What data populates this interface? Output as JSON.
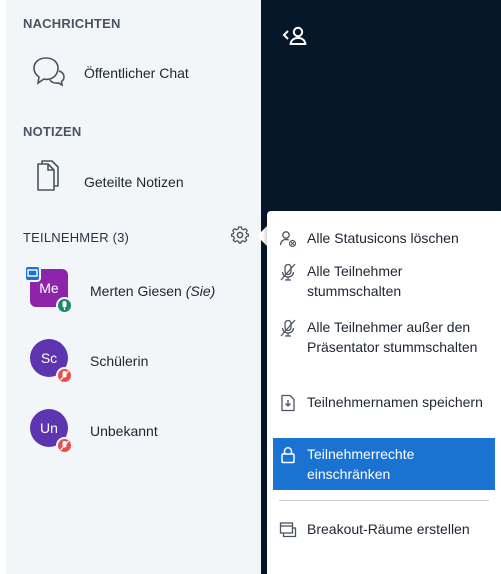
{
  "sidebar": {
    "messages_title": "NACHRICHTEN",
    "public_chat": "Öffentlicher Chat",
    "notes_title": "NOTIZEN",
    "shared_notes": "Geteilte Notizen",
    "participants_title": "TEILNEHMER (3)"
  },
  "users": [
    {
      "initials": "Me",
      "name": "Merten Giesen",
      "you_suffix": "(Sie)",
      "color": "#8e24aa",
      "role": "presenter",
      "audio": "microphone"
    },
    {
      "initials": "Sc",
      "name": "Schülerin",
      "color": "#5e35b1",
      "audio": "muted"
    },
    {
      "initials": "Un",
      "name": "Unbekannt",
      "color": "#5e35b1",
      "audio": "muted"
    }
  ],
  "menu": {
    "items": [
      {
        "label": "Alle Statusicons löschen",
        "icon": "clear-status-icon"
      },
      {
        "label": "Alle Teilnehmer stummschalten",
        "icon": "mute-icon"
      },
      {
        "label": "Alle Teilnehmer außer den Präsentator stummschalten",
        "icon": "mute-icon"
      },
      {
        "label": "Teilnehmernamen speichern",
        "icon": "save-file-icon"
      },
      {
        "label": "Teilnehmerrechte einschränken",
        "icon": "lock-icon",
        "active": true
      },
      {
        "label": "Breakout-Räume erstellen",
        "icon": "rooms-icon"
      }
    ]
  },
  "colors": {
    "accent": "#1a73d1",
    "dark_bg": "#06172a",
    "sidebar_bg": "#f3f6f9",
    "muted_badge": "#e84e4e",
    "mic_badge": "#1a8a6e",
    "presenter_badge": "#1a73d1"
  }
}
